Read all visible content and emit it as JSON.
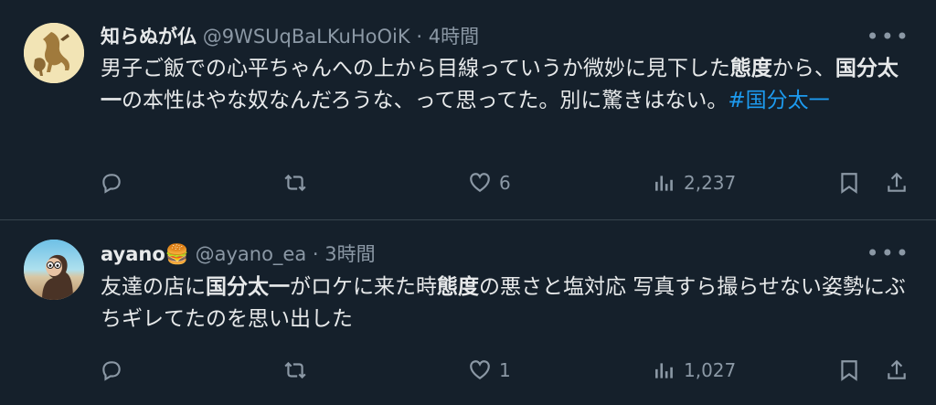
{
  "tweets": [
    {
      "name": "知らぬが仏",
      "handle": "@9WSUqBaLKuHoOiK",
      "separator": "·",
      "time": "4時間",
      "more_label": "•••",
      "text": {
        "p1": "男子ご飯での心平ちゃんへの上から目線っていうか微妙に見下した",
        "b1": "態度",
        "p2": "から、",
        "b2": "国分太一",
        "p3": "の本性はやな奴なんだろうな、って思ってた。別に驚きはない。",
        "hashtag": "#国分太一"
      },
      "likes": "6",
      "views": "2,237"
    },
    {
      "name": "ayano🍔",
      "handle": "@ayano_ea",
      "separator": "·",
      "time": "3時間",
      "more_label": "•••",
      "text": {
        "p1": "友達の店に",
        "b1": "国分太一",
        "p2": "がロケに来た時",
        "b2": "態度",
        "p3": "の悪さと塩対応 写真すら撮らせない姿勢にぶちギレてたのを思い出した"
      },
      "likes": "1",
      "views": "1,027"
    }
  ],
  "icons": {
    "reply": "reply-icon",
    "retweet": "retweet-icon",
    "like": "heart-icon",
    "views": "views-icon",
    "bookmark": "bookmark-icon",
    "share": "share-icon",
    "more": "more-icon"
  },
  "colors": {
    "background": "#15202b",
    "text": "#e7e9ea",
    "secondary": "#8b98a5",
    "link": "#1d9bf0",
    "divider": "#38444d"
  }
}
